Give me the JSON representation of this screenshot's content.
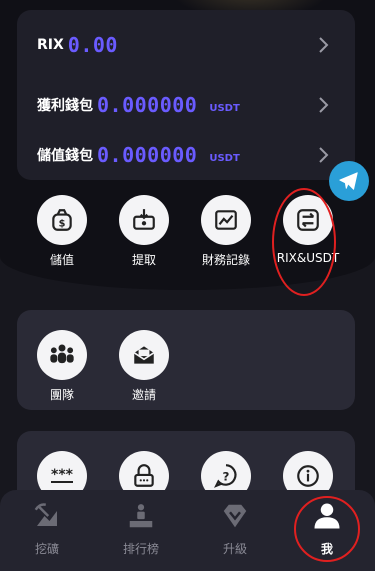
{
  "wallet": {
    "rows": [
      {
        "label": "RIX",
        "amount": "0.00",
        "unit": ""
      },
      {
        "label": "獲利錢包",
        "amount": "0.000000",
        "unit": "USDT"
      },
      {
        "label": "儲值錢包",
        "amount": "0.000000",
        "unit": "USDT"
      }
    ]
  },
  "actions": [
    {
      "label": "儲值",
      "icon": "money-bag-icon"
    },
    {
      "label": "提取",
      "icon": "withdraw-icon"
    },
    {
      "label": "財務記錄",
      "icon": "chart-icon"
    },
    {
      "label": "RIX&USDT",
      "icon": "swap-icon"
    }
  ],
  "team_panel": [
    {
      "label": "團隊",
      "icon": "team-icon"
    },
    {
      "label": "邀請",
      "icon": "invite-icon"
    }
  ],
  "tabs": [
    {
      "label": "挖礦",
      "icon": "mining-icon",
      "active": false
    },
    {
      "label": "排行榜",
      "icon": "podium-icon",
      "active": false
    },
    {
      "label": "升級",
      "icon": "gem-icon",
      "active": false
    },
    {
      "label": "我",
      "icon": "user-icon",
      "active": true
    }
  ],
  "colors": {
    "accent": "#6a5bff",
    "highlight": "#e02020",
    "telegram": "#2a9fd8"
  }
}
